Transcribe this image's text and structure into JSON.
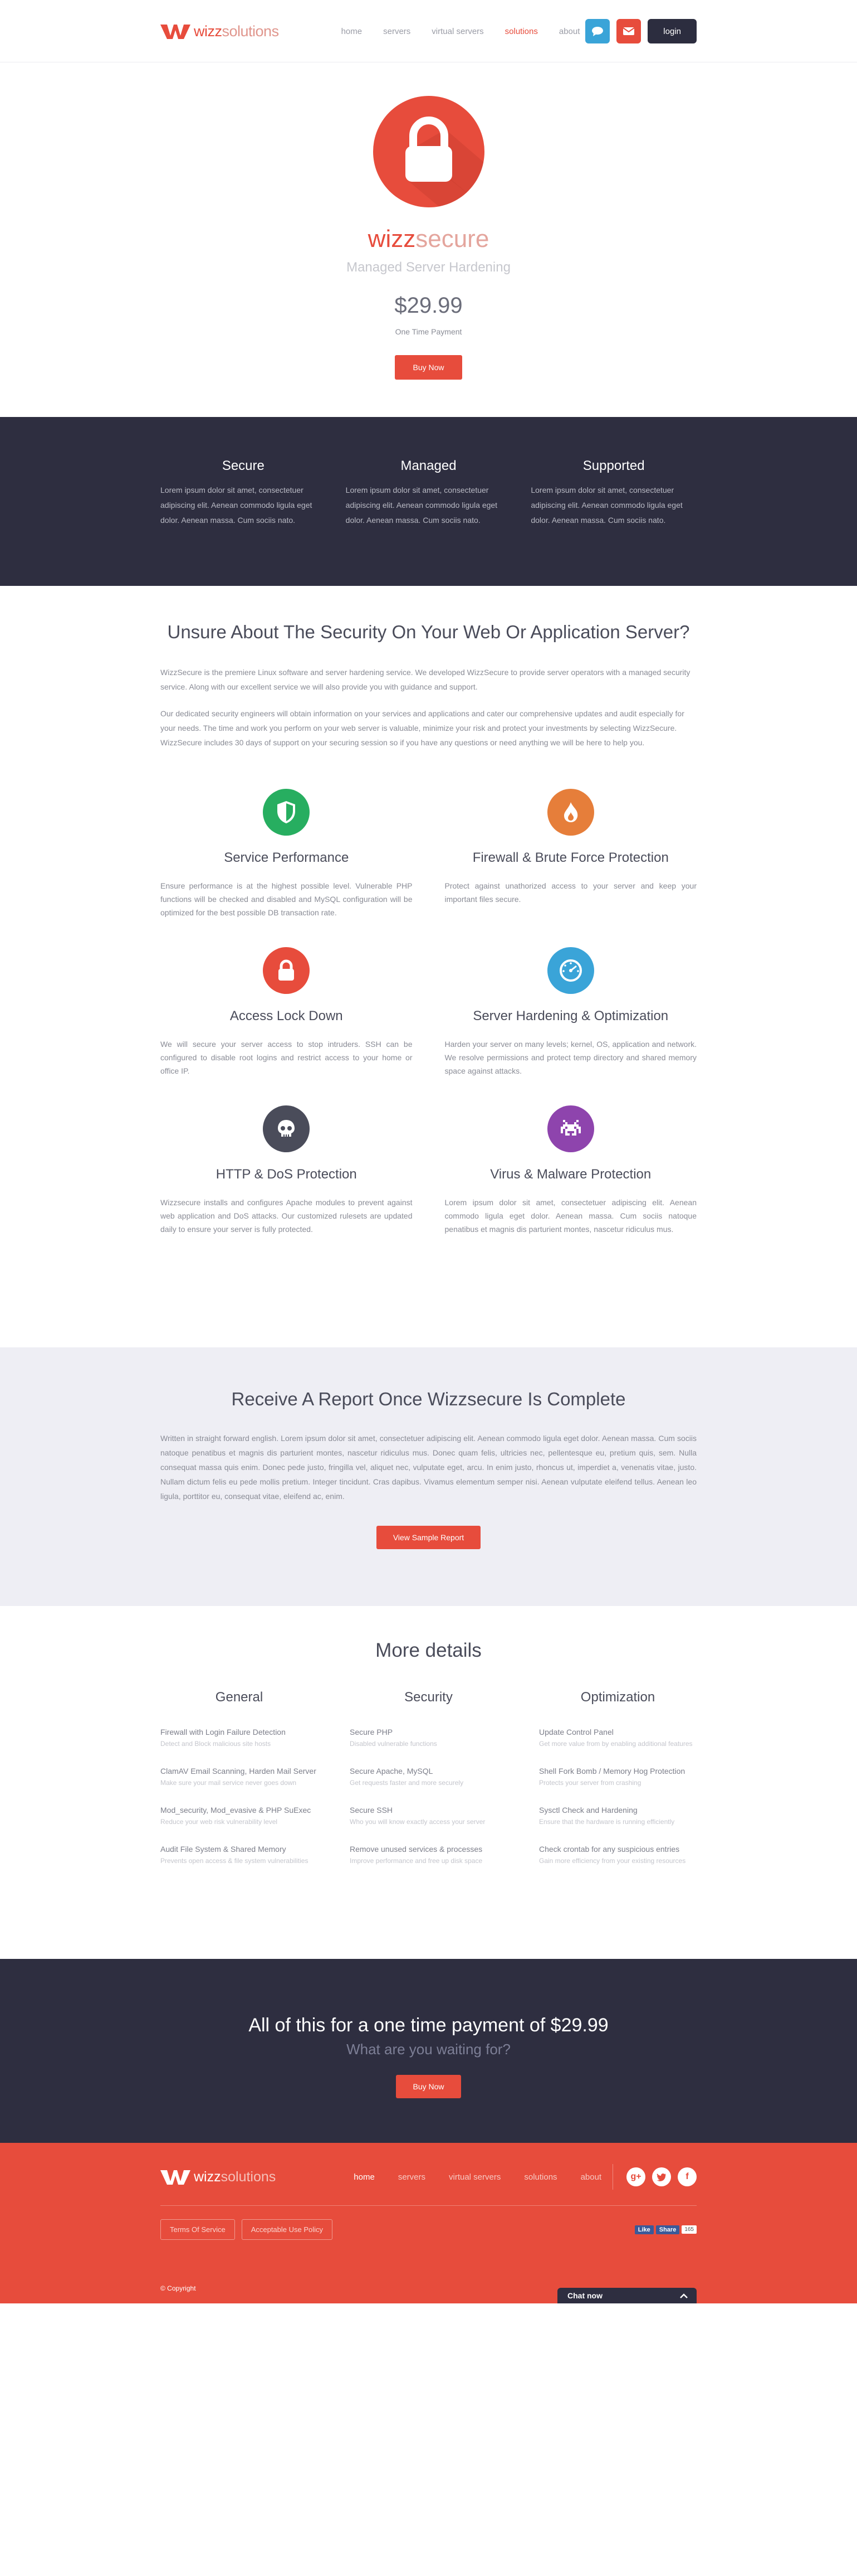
{
  "brand": {
    "name_a": "wizz",
    "name_b": "solutions"
  },
  "nav": [
    "home",
    "servers",
    "virtual servers",
    "solutions",
    "about"
  ],
  "nav_active": "solutions",
  "header": {
    "login": "login",
    "chat_icon": "speech-bubble-icon",
    "mail_icon": "mail-icon"
  },
  "hero": {
    "product_a": "wizz",
    "product_b": "secure",
    "subtitle": "Managed Server Hardening",
    "price": "$29.99",
    "price_note": "One Time Payment",
    "buy": "Buy Now"
  },
  "pillars": [
    {
      "title": "Secure",
      "text": "Lorem ipsum dolor sit amet, consectetuer adipiscing elit. Aenean commodo ligula eget dolor. Aenean massa. Cum sociis nato."
    },
    {
      "title": "Managed",
      "text": "Lorem ipsum dolor sit amet, consectetuer adipiscing elit. Aenean commodo ligula eget dolor. Aenean massa. Cum sociis nato."
    },
    {
      "title": "Supported",
      "text": "Lorem ipsum dolor sit amet, consectetuer adipiscing elit. Aenean commodo ligula eget dolor. Aenean massa. Cum sociis nato."
    }
  ],
  "unsure": {
    "title": "Unsure About The Security On Your Web Or Application Server?",
    "para1": "WizzSecure is the premiere Linux software and server hardening service. We developed WizzSecure to provide server operators with a managed security service. Along with our excellent service we will also provide you with guidance and support.",
    "para2": "Our dedicated security engineers will obtain information on your services and applications and cater our comprehensive updates and audit especially for your needs. The time and work you perform on your web server is valuable, minimize your risk and protect your investments by selecting WizzSecure. WizzSecure includes 30 days of support on your securing session so if you have any questions or need anything we will be here to help you."
  },
  "features": [
    {
      "title": "Service Performance",
      "icon": "shield-icon",
      "color": "#27ae60",
      "text": "Ensure performance is at the highest possible level. Vulnerable PHP functions will be checked and disabled and MySQL configuration will be optimized for the best possible DB transaction rate."
    },
    {
      "title": "Firewall & Brute Force Protection",
      "icon": "flame-icon",
      "color": "#e67e3a",
      "text": "Protect against unathorized access to your server and keep your important files secure."
    },
    {
      "title": "Access Lock Down",
      "icon": "lock-icon",
      "color": "#e74c3c",
      "text": "We will secure your server access to stop intruders. SSH can be configured to disable root logins and restrict access to your home or office IP."
    },
    {
      "title": "Server Hardening & Optimization",
      "icon": "dashboard-icon",
      "color": "#3aa4d8",
      "text": "Harden your server on many levels; kernel, OS, application and network. We resolve permissions and protect temp directory and shared memory space against attacks."
    },
    {
      "title": "HTTP & DoS Protection",
      "icon": "skull-icon",
      "color": "#4a4c5a",
      "text": "Wizzsecure installs and configures Apache modules to prevent against web application and DoS attacks. Our customized rulesets are updated daily to ensure your server is fully protected."
    },
    {
      "title": "Virus & Malware Protection",
      "icon": "space-invader-icon",
      "color": "#8e44ad",
      "text": "Lorem ipsum dolor sit amet, consectetuer adipiscing elit. Aenean commodo ligula eget dolor. Aenean massa. Cum sociis natoque penatibus et magnis dis parturient montes, nascetur ridiculus mus."
    }
  ],
  "report": {
    "title": "Receive A Report Once Wizzsecure Is Complete",
    "text": "Written in straight forward english. Lorem ipsum dolor sit amet, consectetuer adipiscing elit. Aenean commodo ligula eget dolor. Aenean massa. Cum sociis natoque penatibus et magnis dis parturient montes, nascetur ridiculus mus. Donec quam felis, ultricies nec, pellentesque eu, pretium quis, sem. Nulla consequat massa quis enim. Donec pede justo, fringilla vel, aliquet nec, vulputate eget, arcu. In enim justo, rhoncus ut, imperdiet a, venenatis vitae, justo. Nullam dictum felis eu pede mollis pretium. Integer tincidunt. Cras dapibus. Vivamus elementum semper nisi. Aenean vulputate eleifend tellus. Aenean leo ligula, porttitor eu, consequat vitae, eleifend ac, enim.",
    "button": "View Sample Report"
  },
  "details": {
    "title": "More details",
    "columns": [
      {
        "title": "General",
        "items": [
          {
            "t": "Firewall with Login Failure Detection",
            "s": "Detect and Block malicious site hosts"
          },
          {
            "t": "ClamAV Email Scanning, Harden Mail Server",
            "s": "Make sure your mail service never goes down"
          },
          {
            "t": "Mod_security, Mod_evasive & PHP SuExec",
            "s": "Reduce your web risk vulnerability level"
          },
          {
            "t": "Audit File System & Shared Memory",
            "s": "Prevents open access & file system vulnerabilities"
          }
        ]
      },
      {
        "title": "Security",
        "items": [
          {
            "t": "Secure PHP",
            "s": "Disabled vulnerable functions"
          },
          {
            "t": "Secure Apache, MySQL",
            "s": "Get requests faster and more securely"
          },
          {
            "t": "Secure SSH",
            "s": "Who you will know exactly access your server"
          },
          {
            "t": "Remove unused services & processes",
            "s": "Improve performance and free up disk space"
          }
        ]
      },
      {
        "title": "Optimization",
        "items": [
          {
            "t": "Update Control Panel",
            "s": "Get more value from by enabling additional features"
          },
          {
            "t": "Shell Fork Bomb / Memory Hog Protection",
            "s": "Protects your server from crashing"
          },
          {
            "t": "Sysctl Check and Hardening",
            "s": "Ensure that the hardware is running efficiently"
          },
          {
            "t": "Check crontab for any suspicious entries",
            "s": "Gain more efficiency from your existing resources"
          }
        ]
      }
    ]
  },
  "cta": {
    "title": "All of this for a one time payment of $29.99",
    "sub": "What are you waiting for?",
    "button": "Buy Now"
  },
  "footer": {
    "nav": [
      "home",
      "servers",
      "virtual servers",
      "solutions",
      "about"
    ],
    "nav_active": "home",
    "social": [
      "google-plus-icon",
      "twitter-icon",
      "facebook-icon"
    ],
    "terms": "Terms Of Service",
    "aup": "Acceptable Use Policy",
    "fb_like": "Like",
    "fb_share": "Share",
    "fb_count": "165",
    "copyright": "© Copyright",
    "chat": "Chat now"
  },
  "colors": {
    "accent": "#e74c3c",
    "dark": "#2e2e40",
    "blue": "#3aa4d8"
  }
}
